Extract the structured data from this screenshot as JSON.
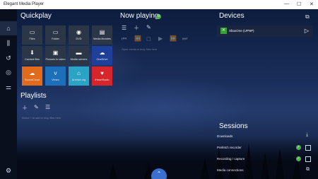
{
  "window": {
    "title": "Elegant Media Player",
    "controls": [
      "—",
      "☐",
      "✕"
    ]
  },
  "sidebar": {
    "items": [
      {
        "icon": "home-icon",
        "glyph": "⌂"
      },
      {
        "icon": "library-icon",
        "glyph": "⫼"
      },
      {
        "icon": "history-icon",
        "glyph": "↺"
      },
      {
        "icon": "podcast-icon",
        "glyph": "◎"
      },
      {
        "icon": "equalizer-icon",
        "glyph": "⚌"
      },
      {
        "icon": "settings-icon",
        "glyph": "⚙"
      }
    ]
  },
  "quickplay": {
    "title": "Quickplay",
    "tiles": [
      {
        "label": "Files",
        "icon": "file-icon",
        "glyph": "▭",
        "bg": "#2b3647"
      },
      {
        "label": "Folder",
        "icon": "folder-icon",
        "glyph": "▭",
        "bg": "#2b3647"
      },
      {
        "label": "DVD",
        "icon": "dvd-icon",
        "glyph": "◉",
        "bg": "#2b3647"
      },
      {
        "label": "Media libraries",
        "icon": "media-library-icon",
        "glyph": "▤",
        "bg": "#2b3647"
      },
      {
        "label": "Cached files",
        "icon": "cache-icon",
        "glyph": "⬇",
        "bg": "#2b3647"
      },
      {
        "label": "Pictures to video",
        "icon": "pictures-icon",
        "glyph": "▣",
        "bg": "#2b3647"
      },
      {
        "label": "Media servers",
        "icon": "media-server-icon",
        "glyph": "▬",
        "bg": "#2b3647"
      },
      {
        "label": "OneDrive",
        "icon": "onedrive-icon",
        "glyph": "☁",
        "bg": "#1e3f9a"
      },
      {
        "label": "SoundCloud",
        "icon": "soundcloud-icon",
        "glyph": "☁",
        "bg": "#e06b1b"
      },
      {
        "label": "Vimeo",
        "icon": "vimeo-icon",
        "glyph": "v",
        "bg": "#1c6fb8"
      },
      {
        "label": "Archive.org",
        "icon": "archive-icon",
        "glyph": "⌂",
        "bg": "#2aa3c4"
      },
      {
        "label": "iHeartRadio",
        "icon": "iheartradio-icon",
        "glyph": "♥",
        "bg": "#d7262b"
      }
    ]
  },
  "nowplaying": {
    "title": "Now playing",
    "badge": "0",
    "empty_hint": "Open media or drop files here"
  },
  "playlists": {
    "title": "Playlists",
    "empty_hint": "Select + to add or drop files here"
  },
  "devices": {
    "title": "Devices",
    "items": [
      {
        "name": "XboxOne (UPNP)"
      }
    ]
  },
  "sessions": {
    "title": "Sessions",
    "items": [
      {
        "label": "Downloads"
      },
      {
        "label": "Prefetch recorder"
      },
      {
        "label": "Recording / capture"
      },
      {
        "label": "Media connections"
      }
    ]
  },
  "colors": {
    "accent": "#3a6fd0",
    "green": "#4caf50"
  }
}
